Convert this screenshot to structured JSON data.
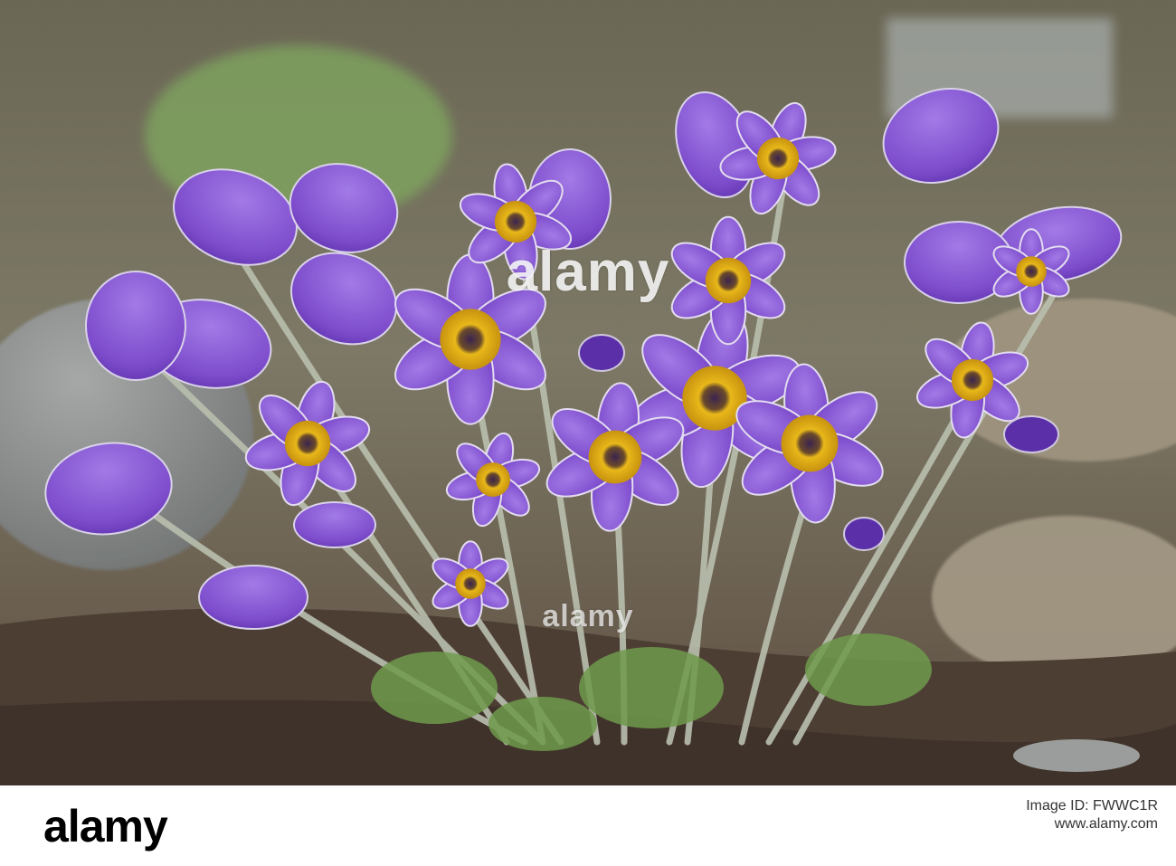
{
  "photo": {
    "subject": "pasque-flower-clump",
    "colors": {
      "petal": "#8a5bd6",
      "petal_dark": "#5b2fa8",
      "center": "#e8b81a",
      "center_dark": "#3b2450",
      "stem": "#b9bfae",
      "foliage": "#6f9a4c",
      "soil": "#4a3b32",
      "rock": "#8c8f8e",
      "background": "#7a7565"
    }
  },
  "watermark": {
    "line1": "alamy",
    "line2": "alamy"
  },
  "footer": {
    "logo_text": "alamy",
    "image_id_label": "Image ID: FWWC1R",
    "image_id": "",
    "site": "www.alamy.com"
  }
}
